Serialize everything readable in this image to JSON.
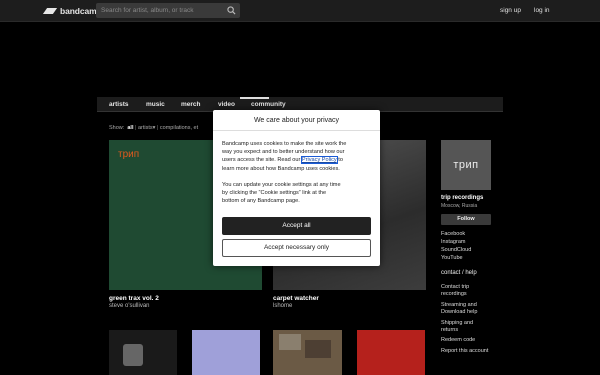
{
  "header": {
    "logo_text": "bandcamp",
    "search_placeholder": "Search for artist, album, or track",
    "signup": "sign up",
    "login": "log in"
  },
  "nav": {
    "tabs": [
      {
        "label": "artists"
      },
      {
        "label": "music"
      },
      {
        "label": "merch"
      },
      {
        "label": "video"
      },
      {
        "label": "community"
      }
    ],
    "active_tab": "music"
  },
  "filter": {
    "show_label": "Show:",
    "all": "all",
    "artists": "artists",
    "compilations": "compilations, et"
  },
  "albums": [
    {
      "title": "green trax vol. 2",
      "artist": "steve o'sullivan",
      "cover_text": "трип",
      "cover_color": "#1f4a32"
    },
    {
      "title": "carpet watcher",
      "artist": "lshome",
      "cover_color": "#3a3a3a"
    }
  ],
  "sidebar": {
    "image_text": "трип",
    "label_name": "trip recordings",
    "location": "Moscow, Russia",
    "follow": "Follow",
    "links": [
      "Facebook",
      "Instagram",
      "SoundCloud",
      "YouTube"
    ],
    "contact_heading": "contact / help",
    "help_links": [
      "Contact trip",
      "recordings",
      "Streaming and",
      "Download help",
      "Shipping and",
      "returns",
      "Redeem code",
      "Report this account"
    ]
  },
  "cookie_modal": {
    "title": "We care about your privacy",
    "body1_a": "Bandcamp uses cookies to make the site work the",
    "body1_b": "way you expect and to better understand how our",
    "body1_c_pre": "users access the site. Read our ",
    "privacy_link": "Privacy Policy",
    "body1_c_post": " to",
    "body1_d": "learn more about how Bandcamp uses cookies.",
    "body2_a": "You can update your cookie settings at any time",
    "body2_b": "by clicking the “Cookie settings” link at the",
    "body2_c": "bottom of any Bandcamp page.",
    "accept_all": "Accept all",
    "accept_necessary": "Accept necessary only"
  },
  "colors": {
    "accent_orange": "#e05a1e",
    "green_cover": "#1f4a32",
    "purple_cover": "#9fa0d9",
    "red_cover": "#b5211c"
  }
}
